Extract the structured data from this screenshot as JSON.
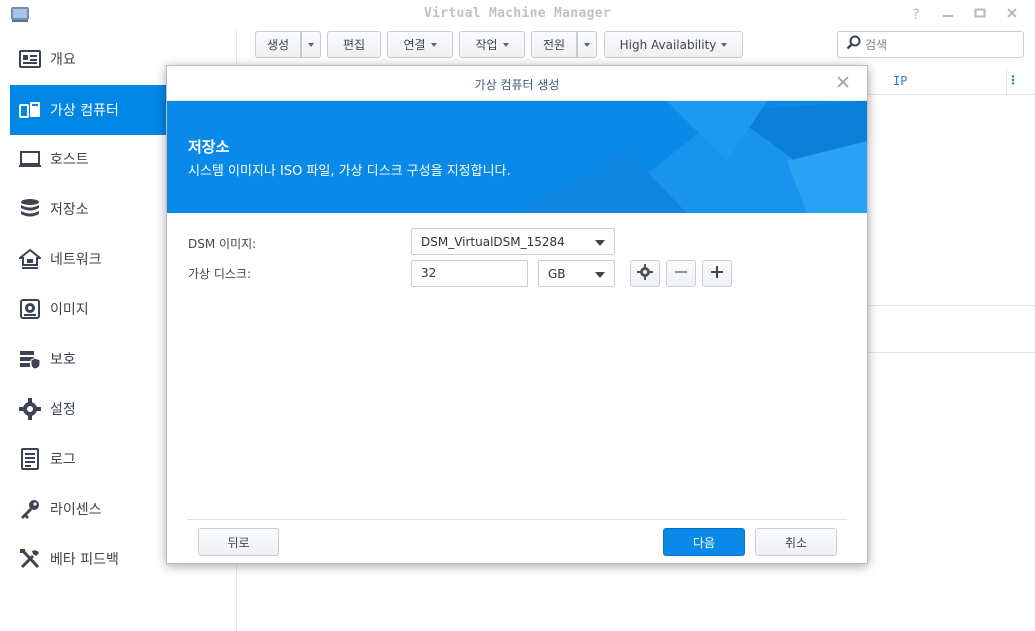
{
  "window": {
    "title": "Virtual Machine Manager",
    "controls": [
      "help-icon",
      "minimize-icon",
      "maximize-icon",
      "close-icon"
    ]
  },
  "sidebar": {
    "items": [
      {
        "label": "개요",
        "icon": "overview-icon"
      },
      {
        "label": "가상 컴퓨터",
        "icon": "virtual-machine-icon",
        "active": true
      },
      {
        "label": "호스트",
        "icon": "host-icon"
      },
      {
        "label": "저장소",
        "icon": "storage-icon"
      },
      {
        "label": "네트워크",
        "icon": "network-icon"
      },
      {
        "label": "이미지",
        "icon": "image-icon"
      },
      {
        "label": "보호",
        "icon": "protection-icon"
      },
      {
        "label": "설정",
        "icon": "settings-icon"
      },
      {
        "label": "로그",
        "icon": "log-icon"
      },
      {
        "label": "라이센스",
        "icon": "license-icon"
      },
      {
        "label": "베타 피드백",
        "icon": "feedback-icon"
      }
    ]
  },
  "toolbar": {
    "create": "생성",
    "edit": "편집",
    "connect": "연결",
    "action": "작업",
    "power": "전원",
    "high_availability": "High Availability"
  },
  "search": {
    "placeholder": "검색"
  },
  "list": {
    "columns": [
      "IP"
    ]
  },
  "dialog": {
    "title": "가상 컴퓨터 생성",
    "banner_title": "저장소",
    "banner_subtitle": "시스템 이미지나 ISO 파일, 가상 디스크 구성을 지정합니다.",
    "dsm_image_label": "DSM 이미지:",
    "dsm_image_value": "DSM_VirtualDSM_15284",
    "virtual_disk_label": "가상 디스크:",
    "virtual_disk_size": "32",
    "virtual_disk_unit": "GB",
    "back_button": "뒤로",
    "next_button": "다음",
    "cancel_button": "취소"
  },
  "colors": {
    "accent": "#0086e5",
    "banner": "#0a8ae8",
    "sidebar_text": "#3b4450"
  }
}
